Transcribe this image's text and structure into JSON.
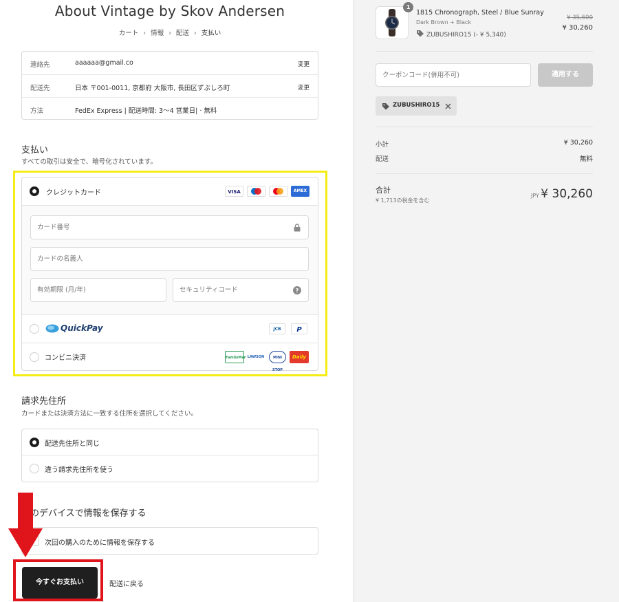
{
  "header": {
    "shop_title": "About Vintage by Skov Andersen",
    "breadcrumb": [
      "カート",
      "情報",
      "配送",
      "支払い"
    ]
  },
  "review": {
    "rows": [
      {
        "label": "連絡先",
        "value": "aaaaaa@gmail.co",
        "action": "変更"
      },
      {
        "label": "配送先",
        "value": "日本 〒001-0011, 京都府 大阪市, 長田区ずぶしろ町",
        "action": "変更"
      },
      {
        "label": "方法",
        "value": "FedEx Express | 配送時間: 3〜4 営業日| · 無料",
        "action": ""
      }
    ]
  },
  "payment": {
    "title": "支払い",
    "subtitle": "すべての取引は安全で、暗号化されています。",
    "credit_card_label": "クレジットカード",
    "card_brands": [
      "VISA",
      "Maestro",
      "Mastercard",
      "AMEX"
    ],
    "card_number_placeholder": "カード番号",
    "card_name_placeholder": "カードの名義人",
    "expiry_placeholder": "有効期限 (月/年)",
    "security_placeholder": "セキュリティコード",
    "quickpay_label": "QuickPay",
    "quickpay_brands": [
      "JCB",
      "PayPal"
    ],
    "konbini_label": "コンビニ決済",
    "konbini_brands": [
      "FamilyMart",
      "LAWSON",
      "MINI STOP",
      "Daily"
    ]
  },
  "billing": {
    "title": "請求先住所",
    "subtitle": "カードまたは決済方法に一致する住所を選択してください。",
    "same_label": "配送先住所と同じ",
    "different_label": "違う請求先住所を使う"
  },
  "save_info": {
    "title": "このデバイスで情報を保存する",
    "checkbox_label": "次回の購入のために情報を保存する"
  },
  "actions": {
    "pay_now": "今すぐお支払い",
    "back_to_shipping": "配送に戻る"
  },
  "order": {
    "product_name": "1815 Chronograph, Steel / Blue Sunray",
    "variant": "Dark Brown + Black",
    "quantity": "1",
    "discount_line": "ZUBUSHIRO15 (- ¥ 5,340)",
    "price_original": "¥ 35,600",
    "price_now": "¥ 30,260",
    "coupon_placeholder": "クーポンコード(併用不可)",
    "apply_label": "適用する",
    "applied_tag": "ZUBUSHIRO15",
    "subtotal_label": "小計",
    "subtotal_value": "¥ 30,260",
    "shipping_label": "配送",
    "shipping_value": "無料",
    "total_label": "合計",
    "tax_note": "¥ 1,713の税金を含む",
    "currency": "JPY",
    "total_value": "¥ 30,260"
  },
  "colors": {
    "highlight": "#f5ec13",
    "cta_border": "#e0141b",
    "cta_bg": "#1f1f1f",
    "sidebar_bg": "#f3f3f3"
  }
}
